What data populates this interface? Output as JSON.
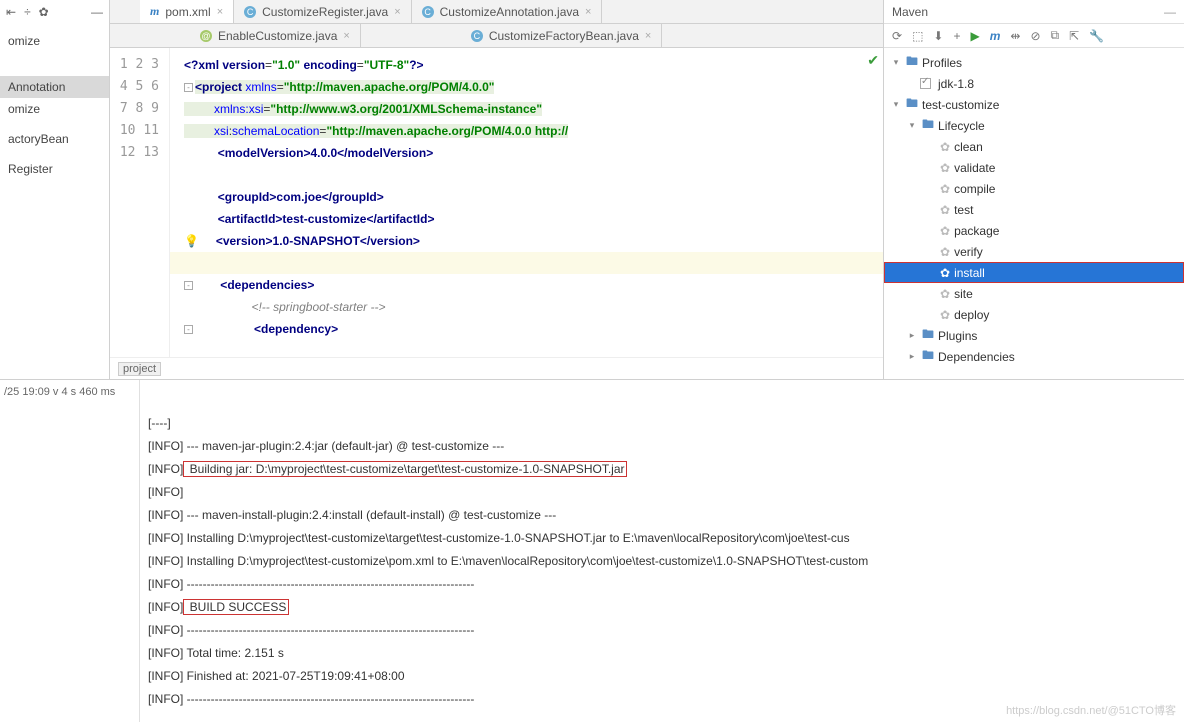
{
  "left": {
    "items": [
      "omize",
      "",
      "",
      "",
      "Annotation",
      "omize",
      "",
      "actoryBean",
      "",
      "Register"
    ],
    "selectedIndex": 4
  },
  "tabs1": [
    {
      "icon": "m",
      "label": "pom.xml",
      "active": true
    },
    {
      "icon": "c",
      "label": "CustomizeRegister.java"
    },
    {
      "icon": "c",
      "label": "CustomizeAnnotation.java"
    }
  ],
  "tabs2": [
    {
      "icon": "a",
      "label": "EnableCustomize.java"
    },
    {
      "icon": "c",
      "label": "CustomizeFactoryBean.java"
    }
  ],
  "code": {
    "l1a": "<?",
    "l1b": "xml version",
    "l1c": "=",
    "l1d": "\"1.0\"",
    "l1e": " encoding",
    "l1f": "=",
    "l1g": "\"UTF-8\"",
    "l1h": "?>",
    "l2a": "<",
    "l2b": "project ",
    "l2c": "xmlns",
    "l2d": "=",
    "l2e": "\"http://maven.apache.org/POM/4.0.0\"",
    "l3a": "xmlns:",
    "l3b": "xsi",
    "l3c": "=",
    "l3d": "\"http://www.w3.org/2001/XMLSchema-instance\"",
    "l4a": "xsi",
    "l4b": ":",
    "l4c": "schemaLocation",
    "l4d": "=",
    "l4e": "\"http://maven.apache.org/POM/4.0.0 http://",
    "l5a": "<",
    "l5b": "modelVersion",
    "l5c": ">4.0.0</",
    "l5d": "modelVersion",
    "l5e": ">",
    "l7a": "<",
    "l7b": "groupId",
    "l7c": ">com.joe</",
    "l7d": "groupId",
    "l7e": ">",
    "l8a": "<",
    "l8b": "artifactId",
    "l8c": ">test-customize</",
    "l8d": "artifactId",
    "l8e": ">",
    "l9a": "<",
    "l9b": "version",
    "l9c": ">1.0-SNAPSHOT</",
    "l9d": "version",
    "l9e": ">",
    "l11a": "<",
    "l11b": "dependencies",
    "l11c": ">",
    "l12": "<!-- springboot-starter -->",
    "l13a": "<",
    "l13b": "dependency",
    "l13c": ">",
    "crumb": "project"
  },
  "maven": {
    "title": "Maven",
    "profiles": "Profiles",
    "jdk": "jdk-1.8",
    "project": "test-customize",
    "lifecycle": "Lifecycle",
    "goals": [
      "clean",
      "validate",
      "compile",
      "test",
      "package",
      "verify",
      "install",
      "site",
      "deploy"
    ],
    "selectedGoal": "install",
    "plugins": "Plugins",
    "deps": "Dependencies"
  },
  "consoleLeft": "/25 19:09 v 4 s 460 ms",
  "console": {
    "l0": "[INFO] --- maven-jar-plugin:2.4:jar (default-jar) @ test-customize ---",
    "l1p": "[INFO]",
    "l1b": " Building jar: D:\\myproject\\test-customize\\target\\test-customize-1.0-SNAPSHOT.jar",
    "l2": "[INFO]",
    "l3": "[INFO] --- maven-install-plugin:2.4:install (default-install) @ test-customize ---",
    "l4": "[INFO] Installing D:\\myproject\\test-customize\\target\\test-customize-1.0-SNAPSHOT.jar to E:\\maven\\localRepository\\com\\joe\\test-cus",
    "l5": "[INFO] Installing D:\\myproject\\test-customize\\pom.xml to E:\\maven\\localRepository\\com\\joe\\test-customize\\1.0-SNAPSHOT\\test-custom",
    "l6": "[INFO] ------------------------------------------------------------------------",
    "l7p": "[INFO]",
    "l7b": " BUILD SUCCESS",
    "l8": "[INFO] ------------------------------------------------------------------------",
    "l9": "[INFO] Total time: 2.151 s",
    "l10": "[INFO] Finished at: 2021-07-25T19:09:41+08:00",
    "l11": "[INFO] ------------------------------------------------------------------------"
  },
  "watermark": "https://blog.csdn.net/@51CTO博客"
}
